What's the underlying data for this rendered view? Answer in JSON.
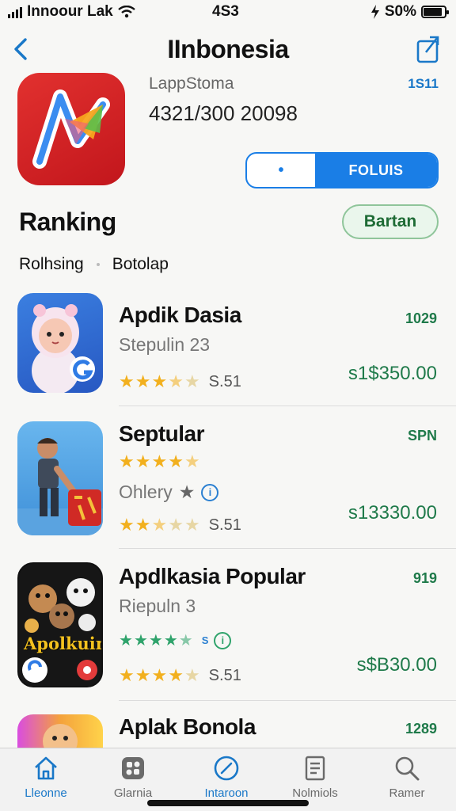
{
  "status_bar": {
    "carrier": "Innoour Lak",
    "time": "4S3",
    "battery": "S0%",
    "battery_level": 0.9
  },
  "nav": {
    "title": "IInbonesia"
  },
  "hero": {
    "store": "LappStoma",
    "size_info": "4321/300 20098",
    "badge": "1S11"
  },
  "segmented": {
    "off_label": "•",
    "on_label": "FOLUIS"
  },
  "section": {
    "title": "Ranking",
    "button": "Bartan"
  },
  "filters": [
    "Rolhsing",
    "Botolap"
  ],
  "apps": [
    {
      "name": "Apdik Dasia",
      "subtitle": "Stepulin 23",
      "rank": "1029",
      "rating_text": "S.51",
      "stars": 3.5,
      "price": "s1$350.00"
    },
    {
      "name": "Septular",
      "subtitle": "Ohlery",
      "rank": "SPN",
      "stars_top": 4.5,
      "rating_text": "S.51",
      "stars": 2.5,
      "price": "s13330.00"
    },
    {
      "name": "Apdlkasia Popular",
      "subtitle": "Riepuln 3",
      "rank": "919",
      "info_label": "S",
      "rating_text": "S.51",
      "stars_green": 4.5,
      "stars": 4,
      "price": "s$B30.00",
      "icon_text": "Apolkuin"
    },
    {
      "name": "Aplak Bonola",
      "rank": "1289"
    }
  ],
  "tabs": [
    {
      "label": "Lleonne"
    },
    {
      "label": "Glarnia"
    },
    {
      "label": "Intaroon"
    },
    {
      "label": "Nolmiols"
    },
    {
      "label": "Ramer"
    }
  ],
  "colors": {
    "accent": "#1a7ee6",
    "price_green": "#1f7a4a",
    "star": "#f2b01e",
    "hero_red": "#d6232a"
  }
}
